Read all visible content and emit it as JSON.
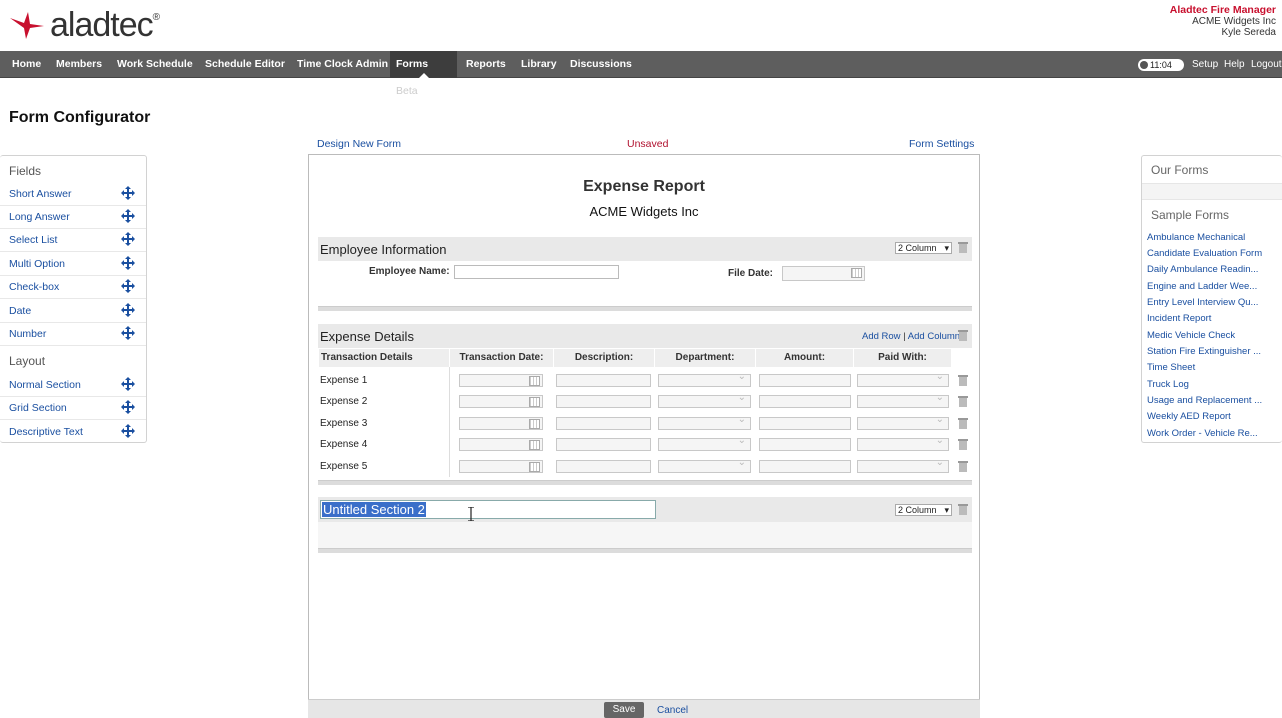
{
  "header": {
    "logo_text": "aladtec",
    "logo_mark": "®",
    "app_name": "Aladtec Fire Manager",
    "org": "ACME Widgets Inc",
    "user": "Kyle Sereda"
  },
  "nav": {
    "items": [
      "Home",
      "Members",
      "Work Schedule",
      "Schedule Editor",
      "Time Clock Admin",
      "Forms",
      "Reports",
      "Library",
      "Discussions"
    ],
    "forms_beta": "Beta",
    "clock": "11:04",
    "setup": "Setup",
    "help": "Help",
    "logout": "Logout"
  },
  "page_title": "Form Configurator",
  "top_links": {
    "design_new": "Design New Form",
    "status": "Unsaved",
    "settings": "Form Settings"
  },
  "fields_panel": {
    "fields_heading": "Fields",
    "fields": [
      "Short Answer",
      "Long Answer",
      "Select List",
      "Multi Option",
      "Check-box",
      "Date",
      "Number"
    ],
    "layout_heading": "Layout",
    "layout": [
      "Normal Section",
      "Grid Section",
      "Descriptive Text"
    ]
  },
  "forms_panel": {
    "our_forms": "Our Forms",
    "sample_forms": "Sample Forms",
    "samples": [
      "Ambulance Mechanical",
      "Candidate Evaluation Form",
      "Daily Ambulance Readin...",
      "Engine and Ladder Wee...",
      "Entry Level Interview Qu...",
      "Incident Report",
      "Medic Vehicle Check",
      "Station Fire Extinguisher ...",
      "Time Sheet",
      "Truck Log",
      "Usage and Replacement ...",
      "Weekly AED Report",
      "Work Order - Vehicle Re..."
    ]
  },
  "form": {
    "title": "Expense Report",
    "subtitle": "ACME Widgets Inc",
    "section1": {
      "title": "Employee Information",
      "columns": "2 Column",
      "employee_name_label": "Employee Name:",
      "file_date_label": "File Date:"
    },
    "section2": {
      "title": "Expense Details",
      "add_row": "Add Row",
      "divider": "|",
      "add_column": "Add Column",
      "headers": [
        "Transaction Details",
        "Transaction Date:",
        "Description:",
        "Department:",
        "Amount:",
        "Paid With:"
      ],
      "rows": [
        "Expense 1",
        "Expense 2",
        "Expense 3",
        "Expense 4",
        "Expense 5"
      ]
    },
    "section3": {
      "title": "Untitled Section 2",
      "columns": "2 Column"
    }
  },
  "footer": {
    "save": "Save",
    "cancel": "Cancel"
  },
  "colors": {
    "nav_bg": "#5e5e5e",
    "link": "#1a4fa0",
    "brand_red": "#c8102e"
  }
}
